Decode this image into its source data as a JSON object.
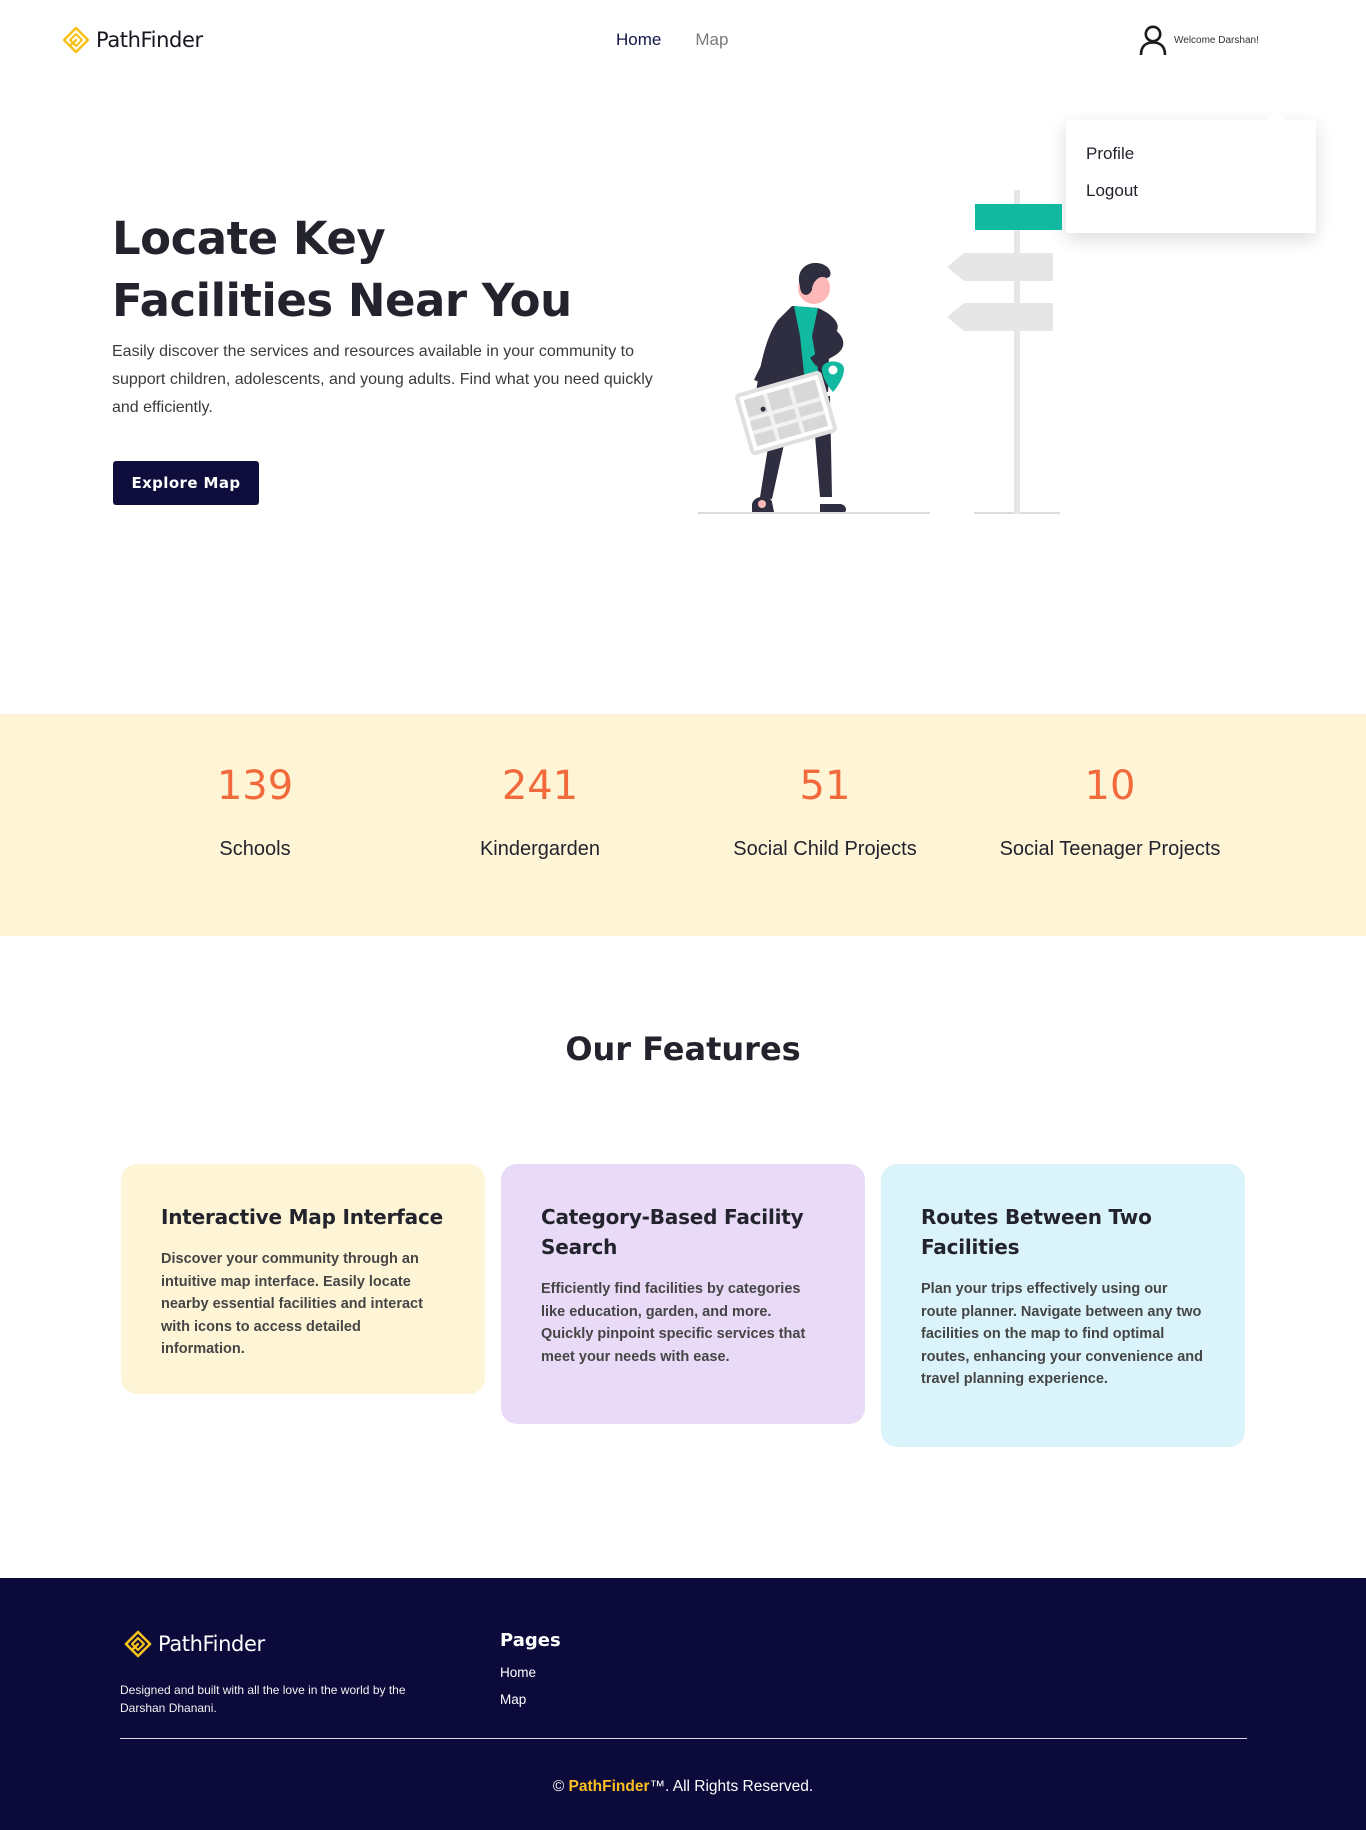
{
  "nav": {
    "brand": "PathFinder",
    "links": [
      "Home",
      "Map"
    ],
    "welcome": "Welcome Darshan!"
  },
  "user_menu": {
    "items": [
      "Profile",
      "Logout"
    ]
  },
  "hero": {
    "title_line1": "Locate Key",
    "title_line2": "Facilities Near You",
    "description": "Easily discover the services and resources available in your community to support children, adolescents, and young adults. Find what you need quickly and efficiently.",
    "cta": "Explore Map"
  },
  "stats": [
    {
      "value": "139",
      "label": "Schools"
    },
    {
      "value": "241",
      "label": "Kindergarden"
    },
    {
      "value": "51",
      "label": "Social Child Projects"
    },
    {
      "value": "10",
      "label": "Social Teenager Projects"
    }
  ],
  "features": {
    "title": "Our Features",
    "cards": [
      {
        "title": "Interactive Map Interface",
        "text": "Discover your community through an intuitive map interface. Easily locate nearby essential facilities and interact with icons to access detailed information.",
        "color": "#fef5d6"
      },
      {
        "title": "Category-Based Facility Search",
        "text": "Efficiently find facilities by categories like education, garden, and more. Quickly pinpoint specific services that meet your needs with ease.",
        "color": "#e9dbf7"
      },
      {
        "title": "Routes Between Two Facilities",
        "text": "Plan your trips effectively using our route planner. Navigate between any two facilities on the map to find optimal routes, enhancing your convenience and travel planning experience.",
        "color": "#dbf4fb"
      }
    ]
  },
  "footer": {
    "brand": "PathFinder",
    "tagline": "Designed and built with all the love in the world by the Darshan Dhanani.",
    "pages_heading": "Pages",
    "links": [
      "Home",
      "Map"
    ],
    "copyright_prefix": "©",
    "copyright_brand": "PathFinder",
    "copyright_suffix": "™. All Rights Reserved."
  },
  "colors": {
    "navy": "#0e0d3c",
    "accent_orange": "#f26a3b",
    "teal": "#10b9a0",
    "yellow": "#fbbf22"
  }
}
